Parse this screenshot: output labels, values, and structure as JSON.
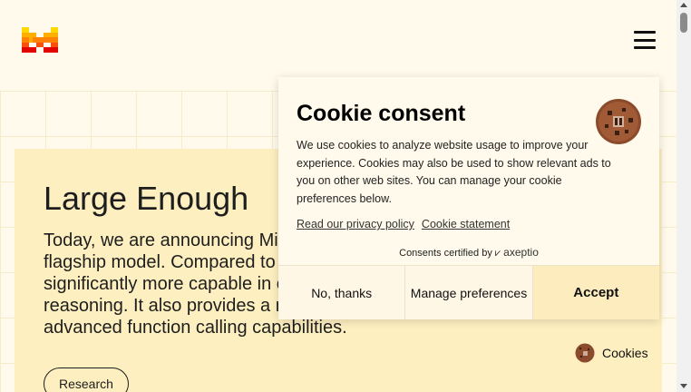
{
  "header": {
    "logo_icon": "mistral-logo-icon",
    "menu_icon": "hamburger-menu-icon"
  },
  "hero": {
    "title": "Large Enough",
    "body_lines": [
      "Today, we are announcing Mi",
      "flagship model. Compared to",
      "significantly more capable in c",
      "reasoning. It also provides a n",
      "advanced function calling capabilities."
    ],
    "pill_label": "Research"
  },
  "cookie": {
    "title": "Cookie consent",
    "icon": "cookie-icon",
    "description": "We use cookies to analyze website usage to improve your experience. Cookies may also be used to show relevant ads to you on other web sites. You can manage your cookie preferences below.",
    "privacy_link": "Read our privacy policy",
    "statement_link": "Cookie statement",
    "certified_text": "Consents certified by",
    "certified_brand": "axeptio",
    "buttons": {
      "no": "No, thanks",
      "manage": "Manage preferences",
      "accept": "Accept"
    }
  },
  "cookies_fab": {
    "label": "Cookies",
    "icon": "cookie-icon"
  },
  "colors": {
    "page_bg": "#fffaeb",
    "hero_bg": "#fdefbf",
    "accept_bg": "#fdecbd",
    "logo_yellow": "#ffd800",
    "logo_orange": "#ff8205",
    "logo_red": "#e10500"
  }
}
